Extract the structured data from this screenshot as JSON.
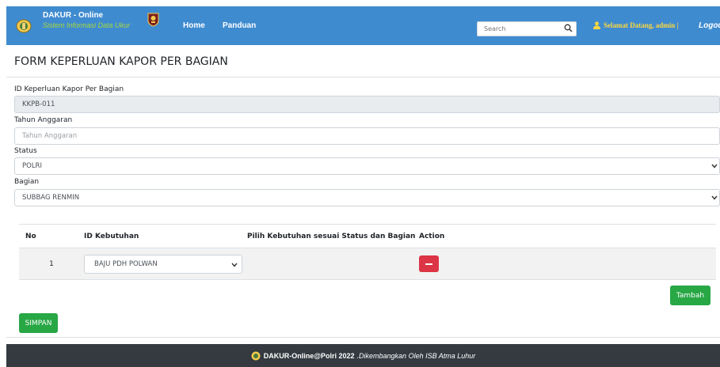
{
  "navbar": {
    "brand_title": "DAKUR - Online",
    "brand_subtitle": "Sistem Informasi Data Ukur",
    "home": "Home",
    "panduan": "Panduan",
    "search_placeholder": "Search",
    "welcome": "Selamat Datang, admin |",
    "logout": "Logout"
  },
  "form": {
    "title": "FORM KEPERLUAN KAPOR PER BAGIAN",
    "id_label": "ID Keperluan Kapor Per Bagian",
    "id_value": "KKPB-011",
    "tahun_label": "Tahun Anggaran",
    "tahun_placeholder": "Tahun Anggaran",
    "status_label": "Status",
    "status_value": "POLRI",
    "bagian_label": "Bagian",
    "bagian_value": "SUBBAG RENMIN"
  },
  "table": {
    "headers": [
      "No",
      "ID Kebutuhan",
      "Pilih Kebutuhan sesuai Status dan Bagian",
      "Action"
    ],
    "rows": [
      {
        "no": "1",
        "kebutuhan": "BAJU PDH POLWAN",
        "pilih": ""
      }
    ]
  },
  "buttons": {
    "tambah": "Tambah",
    "simpan": "SIMPAN"
  },
  "footer": {
    "brand": "DAKUR-Online@Polri 2022",
    "credit": ".Dikembangkan Oleh ISB Atma Luhur"
  },
  "colors": {
    "navbar": "#3f8bd0",
    "brand_subtitle": "#a8d83a",
    "welcome": "#ffd93d",
    "success": "#28a745",
    "danger": "#dc3545",
    "footer": "#343a40"
  }
}
